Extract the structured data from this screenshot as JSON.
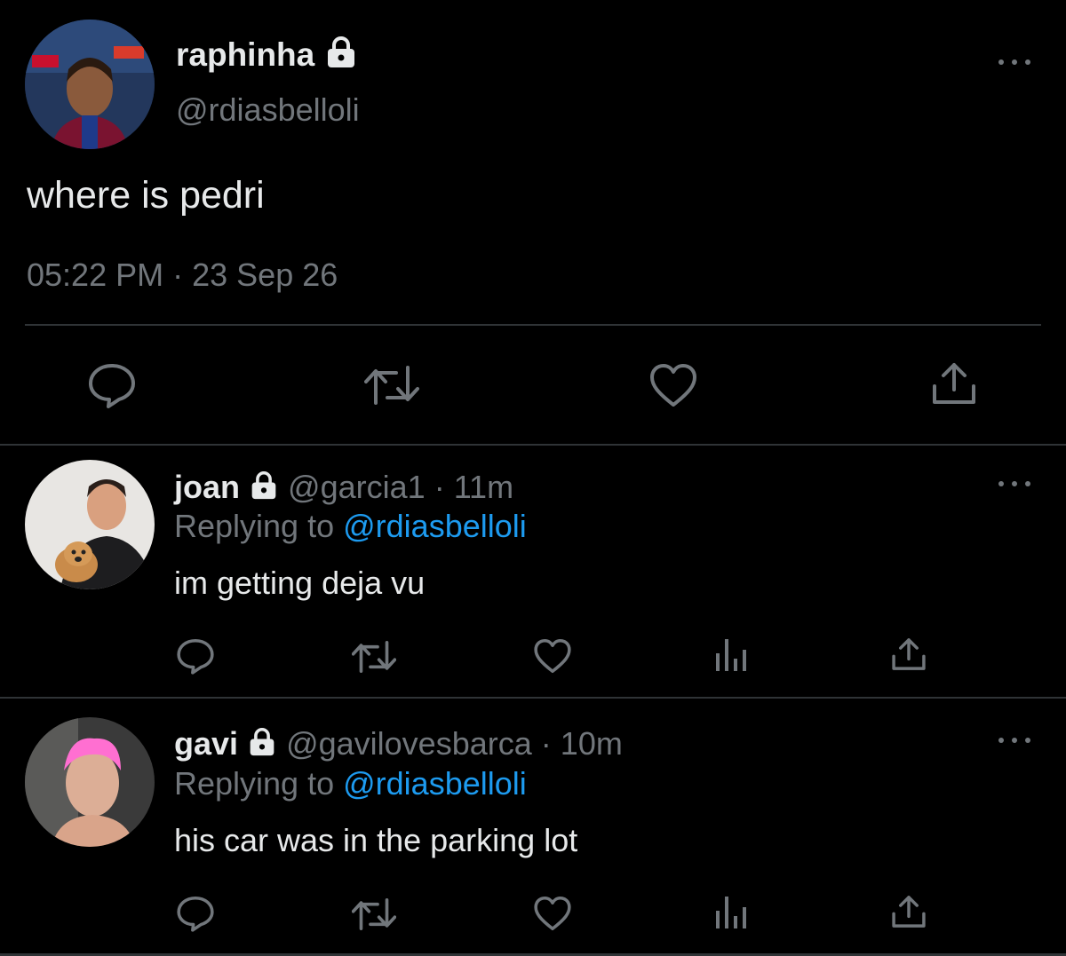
{
  "main_tweet": {
    "display_name": "raphinha",
    "handle": "@rdiasbelloli",
    "text": "where is pedri",
    "timestamp": "05:22 PM",
    "separator": "·",
    "date": "23 Sep 26",
    "icons": [
      "more-icon",
      "reply-icon",
      "retweet-icon",
      "like-icon",
      "share-icon"
    ]
  },
  "replies": [
    {
      "display_name": "joan",
      "handle": "@garcia1",
      "separator": "·",
      "time": "11m",
      "replying_prefix": "Replying to",
      "replying_to": "@rdiasbelloli",
      "text": "im getting deja vu"
    },
    {
      "display_name": "gavi",
      "handle": "@gavilovesbarca",
      "separator": "·",
      "time": "10m",
      "replying_prefix": "Replying to",
      "replying_to": "@rdiasbelloli",
      "text": "his car was in the parking lot"
    }
  ],
  "colors": {
    "background": "#000000",
    "text": "#e7e9ea",
    "muted": "#71767b",
    "link": "#1d9bf0",
    "divider": "#2f3336"
  }
}
